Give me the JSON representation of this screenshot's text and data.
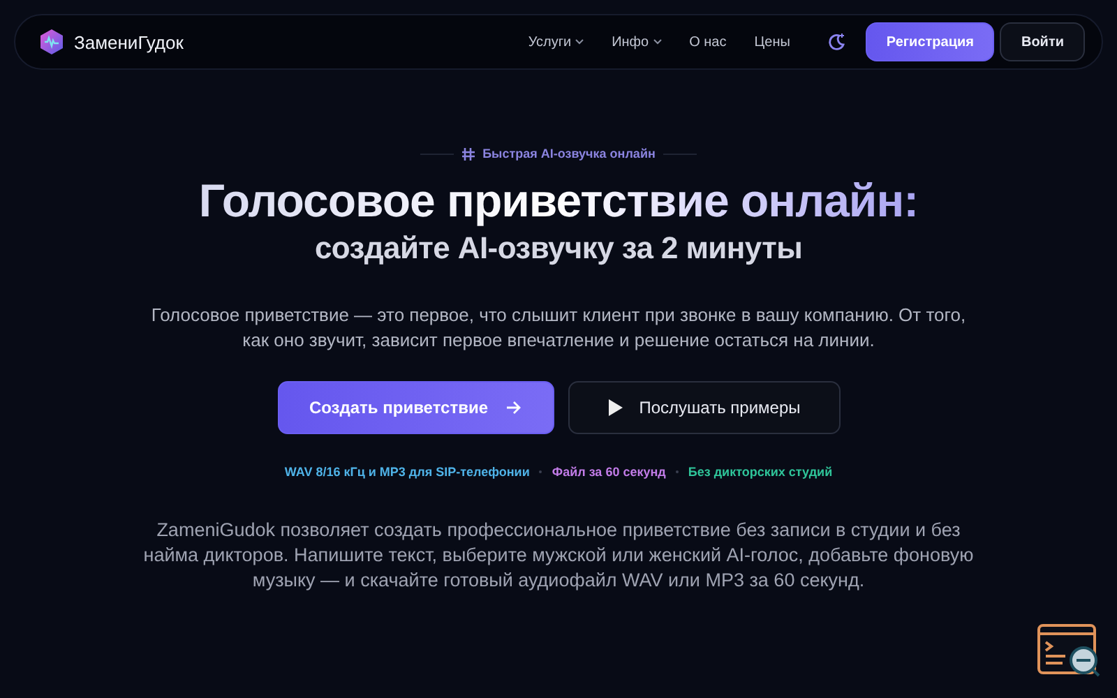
{
  "header": {
    "brand": "ЗамениГудок",
    "nav": [
      {
        "label": "Услуги",
        "has_menu": true
      },
      {
        "label": "Инфо",
        "has_menu": true
      },
      {
        "label": "О нас",
        "has_menu": false
      },
      {
        "label": "Цены",
        "has_menu": false
      }
    ],
    "buttons": [
      {
        "label": "Регистрация",
        "kind": "primary"
      },
      {
        "label": "Войти",
        "kind": "secondary"
      }
    ]
  },
  "hero": {
    "eyebrow": "Быстрая AI-озвучка онлайн",
    "title": "Голосовое приветствие онлайн:",
    "subtitle": "создайте AI-озвучку за 2 минуты",
    "lead": "Голосовое приветствие — это первое, что слышит клиент при звонке в вашу компанию. От того, как оно звучит, зависит первое впечатление и решение остаться на линии.",
    "buttons": [
      {
        "label": "Создать приветствие",
        "kind": "primary"
      },
      {
        "label": "Послушать примеры",
        "kind": "secondary"
      }
    ],
    "features": [
      {
        "label": "WAV 8/16 кГц и MP3 для SIP-телефонии",
        "color": "#4fb3e8"
      },
      {
        "label": "Файл за 60 секунд",
        "color": "#c27ce8"
      },
      {
        "label": "Без дикторских студий",
        "color": "#2fc59a"
      }
    ],
    "description": "ZameniGudok позволяет создать профессиональное приветствие без записи в студии и без найма дикторов. Напишите текст, выберите мужской или женский AI-голос, добавьте фоновую музыку — и скачайте готовый аудиофайл WAV или MP3 за 60 секунд."
  }
}
